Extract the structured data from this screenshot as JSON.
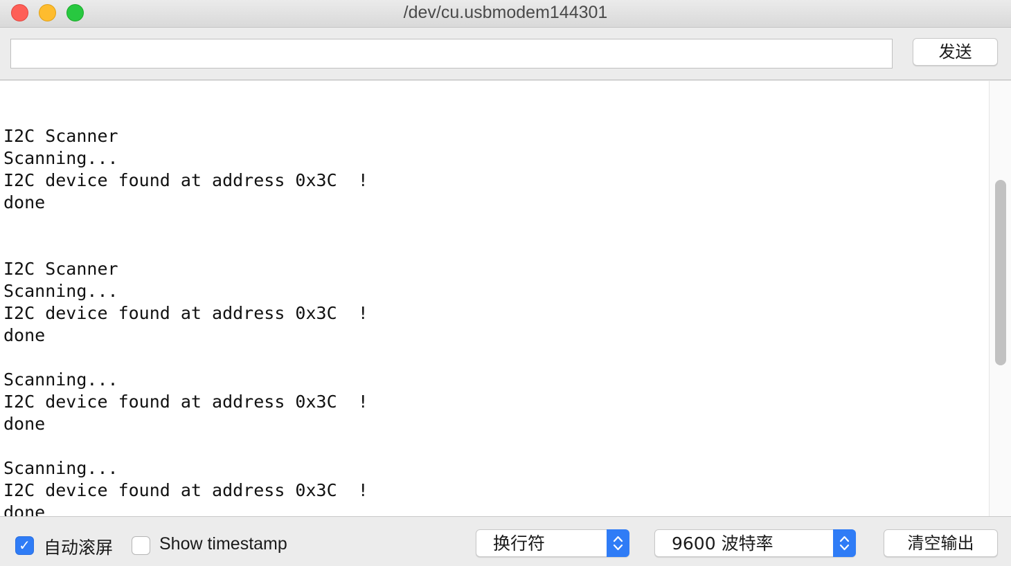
{
  "window": {
    "title": "/dev/cu.usbmodem144301"
  },
  "input_row": {
    "value": "",
    "send_label": "发送"
  },
  "output": {
    "lines": [
      "",
      "I2C Scanner",
      "Scanning...",
      "I2C device found at address 0x3C  !",
      "done",
      "",
      "",
      "I2C Scanner",
      "Scanning...",
      "I2C device found at address 0x3C  !",
      "done",
      "",
      "Scanning...",
      "I2C device found at address 0x3C  !",
      "done",
      "",
      "Scanning...",
      "I2C device found at address 0x3C  !",
      "done"
    ]
  },
  "bottom_bar": {
    "autoscroll_label": "自动滚屏",
    "autoscroll_checked": true,
    "timestamp_label": "Show timestamp",
    "timestamp_checked": false,
    "line_ending": "换行符",
    "baud_rate": "9600 波特率",
    "clear_label": "清空输出"
  },
  "colors": {
    "accent": "#2f7cf6",
    "close": "#fe5f57",
    "minimize": "#febc2e",
    "maximize": "#28c840"
  }
}
